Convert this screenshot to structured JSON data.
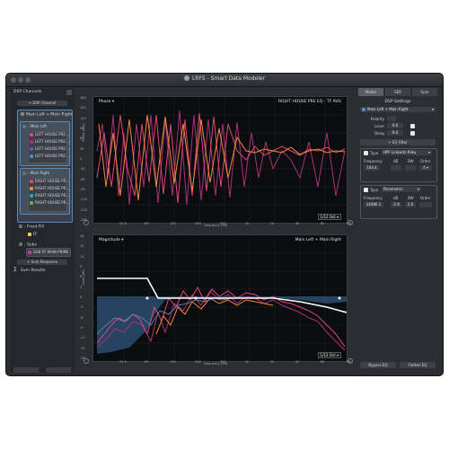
{
  "window": {
    "title": "LRFS - Smart Data Modeler"
  },
  "sidebar": {
    "header": "DSP Channels",
    "dsp_channel_label": "+ DSP Channel",
    "main_group": "Main Left + Main Right",
    "left_group": {
      "label": "Main Left",
      "items": [
        "LEFT HOUSE PRE ...",
        "LEFT HOUSE PRE ...",
        "LEFT HOUSE PRE ...",
        "LEFT HOUSE PRE ..."
      ]
    },
    "right_group": {
      "label": "Main Right",
      "items": [
        "RIGHT HOUSE PR...",
        "RIGHT HOUSE PR...",
        "RIGHT HOUSE PR...",
        "RIGHT HOUSE PR..."
      ]
    },
    "front_fill": {
      "label": "Front Fill",
      "item": "FF"
    },
    "subs": {
      "label": "Subs",
      "item": "SUB AT MAIN PRIME"
    },
    "sum_response_label": "+ Sum Response",
    "sum_results_label": "Sum Results"
  },
  "phase_panel": {
    "label": "Phase",
    "trace_label": "RIGHT HOUSE PRE EQ - TF AVG",
    "ylabel": "Phase (deg)",
    "xlabel": "Frequency (Hz)",
    "y_ticks": [
      "180",
      "150",
      "120",
      "90",
      "60",
      "30",
      "0",
      "-30",
      "-60",
      "-90",
      "-120",
      "-150",
      "-180"
    ],
    "x_ticks": [
      "31.5",
      "63",
      "125",
      "250",
      "500",
      "1k",
      "2k",
      "4k",
      "8k",
      "16k"
    ],
    "smoothing": "1/12 Oct"
  },
  "magnitude_panel": {
    "label": "Magnitude",
    "trace_label": "Main Left + Main Right",
    "ylabel": "Level (dB)",
    "xlabel": "Frequency (Hz)",
    "y_ticks": [
      "18",
      "15",
      "12",
      "9",
      "6",
      "3",
      "0",
      "-3",
      "-6",
      "-9",
      "-12",
      "-15",
      "-18"
    ],
    "x_ticks": [
      "31.5",
      "63",
      "125",
      "250",
      "500",
      "1k",
      "2k",
      "4k",
      "8k",
      "16k"
    ],
    "smoothing": "1/12 Oct"
  },
  "right_panel": {
    "tabs": [
      "Model",
      "SER",
      "Sum"
    ],
    "header": "DSP Settings",
    "channel_select": "Main Left + Main Right",
    "polarity_label": "Polarity",
    "level_label": "Level",
    "level_value": "0.0",
    "delay_label": "Delay",
    "delay_value": "0.0",
    "eq_filter_label": "+ EQ Filter",
    "filter1": {
      "type_label": "Type",
      "type": "HPF Linkwitz-Riley",
      "col_labels": [
        "Frequency",
        "dB",
        "BW",
        "Order"
      ],
      "frequency": "104.4",
      "order": "4"
    },
    "filter2": {
      "type_label": "Type",
      "type": "Parametric",
      "col_labels": [
        "Frequency",
        "dB",
        "BW",
        "Order"
      ],
      "frequency": "14486.1",
      "db": "-2.6",
      "bw": "2.0"
    },
    "bypass_label": "Bypass EQ",
    "flatten_label": "Flatten EQ"
  },
  "colors": {
    "accent": "#5d89b6",
    "trace_pink": "#e0467a",
    "trace_orange": "#f08a3c",
    "trace_magenta": "#a8327a",
    "target_white": "#ffffff",
    "area_blue": "#2b4e6e"
  }
}
